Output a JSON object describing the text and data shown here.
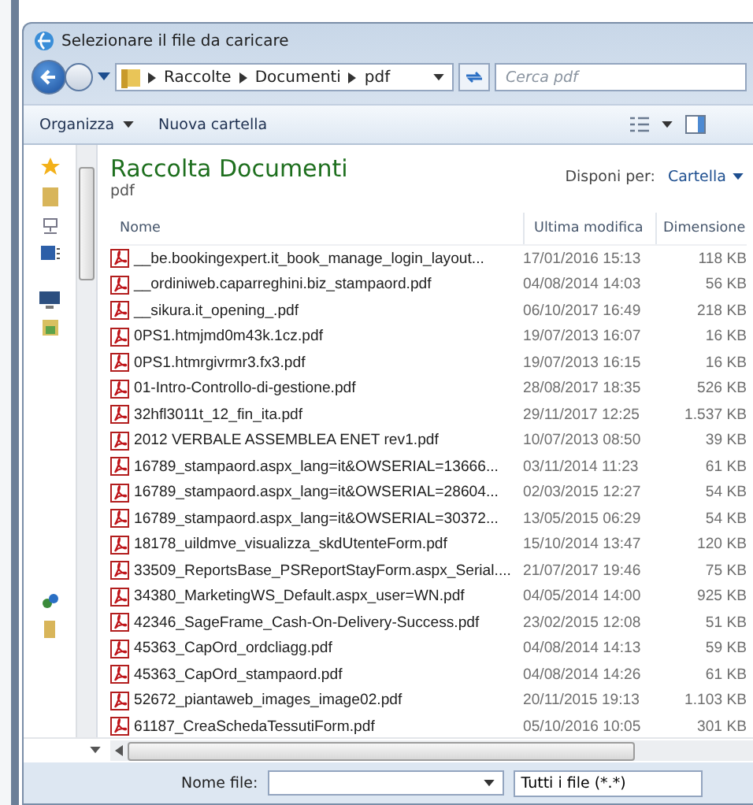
{
  "window": {
    "title": "Selezionare il file da caricare"
  },
  "address": {
    "breadcrumbs": [
      "Raccolte",
      "Documenti",
      "pdf"
    ]
  },
  "search": {
    "placeholder": "Cerca pdf"
  },
  "toolbar": [
    {
      "label": "Organizza",
      "dropdown": true
    },
    {
      "label": "Nuova cartella",
      "dropdown": false
    }
  ],
  "library": {
    "title": "Raccolta Documenti",
    "subtitle": "pdf",
    "arrange_label": "Disponi per:",
    "arrange_value": "Cartella"
  },
  "table": {
    "columns": [
      "Nome",
      "Ultima modifica",
      "Dimensione"
    ],
    "rows": [
      {
        "name": "__be.bookingexpert.it_book_manage_login_layout...",
        "modified": "17/01/2016 15:13",
        "size": "118 KB"
      },
      {
        "name": "__ordiniweb.caparreghini.biz_stampaord.pdf",
        "modified": "04/08/2014 14:03",
        "size": "56 KB"
      },
      {
        "name": "__sikura.it_opening_.pdf",
        "modified": "06/10/2017 16:49",
        "size": "218 KB"
      },
      {
        "name": "0PS1.htmjmd0m43k.1cz.pdf",
        "modified": "19/07/2013 16:07",
        "size": "16 KB"
      },
      {
        "name": "0PS1.htmrgivrmr3.fx3.pdf",
        "modified": "19/07/2013 16:15",
        "size": "16 KB"
      },
      {
        "name": "01-Intro-Controllo-di-gestione.pdf",
        "modified": "28/08/2017 18:35",
        "size": "526 KB"
      },
      {
        "name": "32hfl3011t_12_fin_ita.pdf",
        "modified": "29/11/2017 12:25",
        "size": "1.537 KB"
      },
      {
        "name": "2012 VERBALE ASSEMBLEA ENET rev1.pdf",
        "modified": "10/07/2013 08:50",
        "size": "39 KB"
      },
      {
        "name": "16789_stampaord.aspx_lang=it&OWSERIAL=13666...",
        "modified": "03/11/2014 11:23",
        "size": "61 KB"
      },
      {
        "name": "16789_stampaord.aspx_lang=it&OWSERIAL=28604...",
        "modified": "02/03/2015 12:27",
        "size": "54 KB"
      },
      {
        "name": "16789_stampaord.aspx_lang=it&OWSERIAL=30372...",
        "modified": "13/05/2015 06:29",
        "size": "54 KB"
      },
      {
        "name": "18178_uildmve_visualizza_skdUtenteForm.pdf",
        "modified": "15/10/2014 13:47",
        "size": "120 KB"
      },
      {
        "name": "33509_ReportsBase_PSReportStayForm.aspx_Serial....",
        "modified": "21/07/2017 19:46",
        "size": "75 KB"
      },
      {
        "name": "34380_MarketingWS_Default.aspx_user=WN.pdf",
        "modified": "04/05/2014 14:00",
        "size": "925 KB"
      },
      {
        "name": "42346_SageFrame_Cash-On-Delivery-Success.pdf",
        "modified": "23/02/2015 12:08",
        "size": "51 KB"
      },
      {
        "name": "45363_CapOrd_ordcliagg.pdf",
        "modified": "04/08/2014 14:13",
        "size": "59 KB"
      },
      {
        "name": "45363_CapOrd_stampaord.pdf",
        "modified": "04/08/2014 14:26",
        "size": "61 KB"
      },
      {
        "name": "52672_piantaweb_images_image02.pdf",
        "modified": "20/11/2015 19:13",
        "size": "1.103 KB"
      },
      {
        "name": "61187_CreaSchedaTessutiForm.pdf",
        "modified": "05/10/2016 10:05",
        "size": "301 KB"
      }
    ]
  },
  "footer": {
    "filename_label": "Nome file:",
    "file_type": "Tutti i file (*.*)"
  }
}
